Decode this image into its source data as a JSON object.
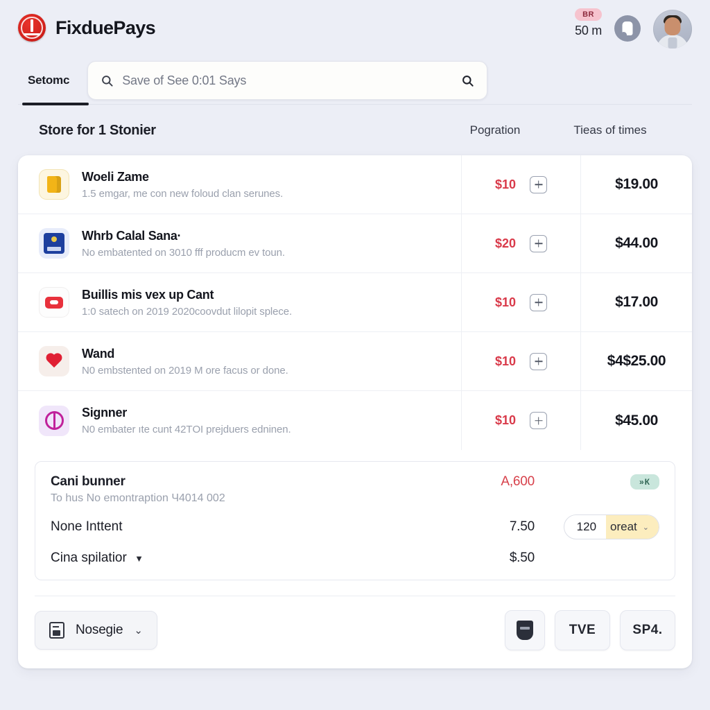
{
  "header": {
    "brand_name": "FixduePays",
    "logo_icon": "circle-logo-icon",
    "badge_text": "BR",
    "meter_text": "50 m",
    "status_icon": "thumb-circle-icon",
    "avatar_icon": "user-avatar"
  },
  "nav": {
    "tab_label": "Setomc",
    "search": {
      "placeholder": "Save of See 0:01 Says",
      "left_icon": "search-icon",
      "right_icon": "search-icon"
    }
  },
  "table": {
    "headers": {
      "main": "Store for 1 Stonier",
      "col_a": "Pogration",
      "col_b": "Tieas of times"
    },
    "rows": [
      {
        "icon": "folder-icon",
        "title": "Woeli Zame",
        "desc": "1.5 emgar, me con new foloud clan serunes.",
        "price": "$10",
        "add_icon": "plus-icon",
        "total": "$19.00"
      },
      {
        "icon": "blue-card-icon",
        "title": "Whrb Calal Sana·",
        "desc": "No embatented on 3010 fff producm ev toun.",
        "price": "$20",
        "add_icon": "plus-icon",
        "total": "$44.00"
      },
      {
        "icon": "red-capsule-icon",
        "title": "Buillis mis vex up Cant",
        "desc": "1:0 satech on 2019 2020coovdut lilopit splece.",
        "price": "$10",
        "add_icon": "plus-icon",
        "total": "$17.00"
      },
      {
        "icon": "heart-icon",
        "title": "Wand",
        "desc": "N0 embstented on 2019 M ore facus or done.",
        "price": "$10",
        "add_icon": "plus-icon",
        "total": "$4$25.00"
      },
      {
        "icon": "purple-circle-icon",
        "title": "Signner",
        "desc": "N0 embater ıte cunt 42ТOІ prejduers edninen.",
        "price": "$10",
        "add_icon": "plus-icon",
        "total": "$45.00"
      }
    ]
  },
  "summary": {
    "title": "Cani bunner",
    "title_value": "A,600",
    "subtitle": "To hus No emontraption Ч4014 002",
    "close_badge": "»К",
    "line2_label": "None Inttent",
    "line2_value": "7.50",
    "qty_number": "120",
    "qty_label": "oreat",
    "qty_caret": "⌄",
    "line3_label": "Cina spilatior",
    "line3_caret": "▼",
    "line3_value": "$.50"
  },
  "bottom": {
    "select_label": "Nosegie",
    "select_icon": "document-icon",
    "select_caret": "⌄",
    "buttons": [
      {
        "icon": "shield-icon",
        "label": ""
      },
      {
        "icon": "",
        "label": "TVE"
      },
      {
        "icon": "",
        "label": "SP4."
      }
    ]
  },
  "colors": {
    "accent_red": "#d93a4a",
    "brand_red": "#cf1f1a",
    "page_bg": "#eceef6",
    "badge_pink": "#f6c3ce",
    "badge_green": "#c9e6dc",
    "qty_yellow": "#fcedbe"
  }
}
